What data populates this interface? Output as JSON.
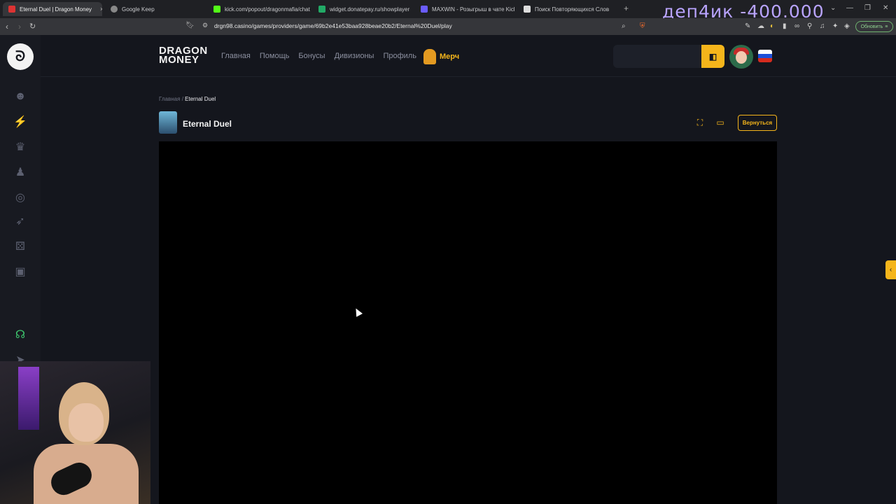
{
  "browser": {
    "tabs": [
      {
        "label": "Eternal Duel | Dragon Money",
        "active": true
      },
      {
        "label": "Google Keep"
      },
      {
        "label": "kick.com/popout/dragonmafia/chat"
      },
      {
        "label": "widget.donatepay.ru/showplayer"
      },
      {
        "label": "MAXWIN - Розыгрыш в чате Kick"
      },
      {
        "label": "Поиск Повторяющихся Слов"
      }
    ],
    "close_tab": "×",
    "new_tab": "+",
    "url": "drgn98.casino/games/providers/game/69b2e41e53baa928beae20b2/Eternal%20Duel/play",
    "update_label": "Обновить"
  },
  "stream_overlay": "деп4ик -400.000",
  "site": {
    "brand_line1": "DRAGON",
    "brand_line2": "MONEY",
    "nav": [
      "Главная",
      "Помощь",
      "Бонусы",
      "Дивизионы",
      "Профиль"
    ],
    "merch_label": "Мерч",
    "wallet_icon": "wallet-icon"
  },
  "page": {
    "breadcrumb_home": "Главная",
    "breadcrumb_sep": "/",
    "breadcrumb_current": "Eternal Duel",
    "game_title": "Eternal Duel",
    "back_label": "Вернуться"
  },
  "colors": {
    "accent": "#f5b51b",
    "background": "#14161d",
    "support_icon": "#3ec96f"
  }
}
